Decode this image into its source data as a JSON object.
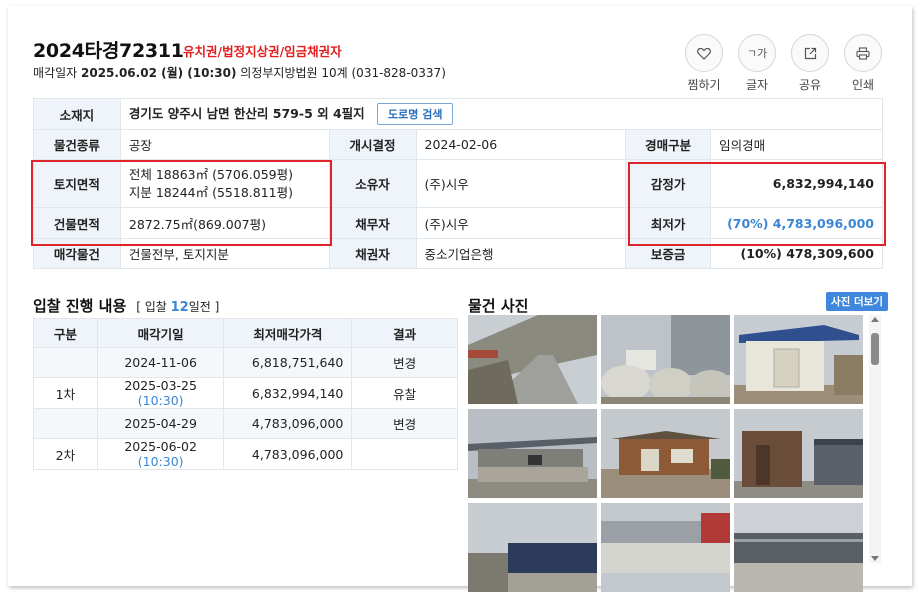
{
  "header": {
    "case_no": "2024타경72311",
    "tags": "유치권/법정지상권/임금채권자",
    "sale_date_label": "매각일자",
    "sale_date": "2025.06.02 (월) (10:30)",
    "court": "의정부지방법원 10계 (031-828-0337)"
  },
  "actions": [
    {
      "label": "찜하기",
      "icon": "heart-icon",
      "glyph": "♡"
    },
    {
      "label": "글자",
      "icon": "font-size-icon",
      "glyph": "ㄱ가"
    },
    {
      "label": "공유",
      "icon": "share-icon",
      "glyph": "⇱"
    },
    {
      "label": "인쇄",
      "icon": "print-icon",
      "glyph": "⎙"
    }
  ],
  "info": {
    "location_label": "소재지",
    "location": "경기도 양주시 남면 한산리 579-5 외 4필지",
    "road_button": "도로명 검색",
    "type_label": "물건종류",
    "type": "공장",
    "open_label": "개시결정",
    "open_date": "2024-02-06",
    "auction_label": "경매구분",
    "auction_type": "임의경매",
    "land_label": "토지면적",
    "land_total": "전체 18863㎡ (5706.059평)",
    "land_share": "지분 18244㎡ (5518.811평)",
    "owner_label": "소유자",
    "owner": "(주)시우",
    "appraisal_label": "감정가",
    "appraisal": "6,832,994,140",
    "bldg_label": "건물면적",
    "bldg_area": "2872.75㎡(869.007평)",
    "debtor_label": "채무자",
    "debtor": "(주)시우",
    "min_label": "최저가",
    "min_price": "(70%) 4,783,096,000",
    "item_label": "매각물건",
    "item": "건물전부, 토지지분",
    "creditor_label": "채권자",
    "creditor": "중소기업은행",
    "deposit_label": "보증금",
    "deposit": "(10%) 478,309,600"
  },
  "bidding": {
    "title": "입찰 진행 내용",
    "note_prefix": "[ 입찰",
    "note_days": "12",
    "note_suffix": "일전 ]",
    "columns": [
      "구분",
      "매각기일",
      "최저매각가격",
      "결과"
    ],
    "rows": [
      {
        "round": "",
        "date": "2024-11-06",
        "time": "",
        "price": "6,818,751,640",
        "result": "변경"
      },
      {
        "round": "1차",
        "date": "2025-03-25",
        "time": "(10:30)",
        "price": "6,832,994,140",
        "result": "유찰"
      },
      {
        "round": "",
        "date": "2025-04-29",
        "time": "",
        "price": "4,783,096,000",
        "result": "변경"
      },
      {
        "round": "2차",
        "date": "2025-06-02",
        "time": "(10:30)",
        "price": "4,783,096,000",
        "result": ""
      }
    ]
  },
  "photos": {
    "title": "물건 사진",
    "more_button": "사진 더보기"
  },
  "colors": {
    "accent": "#3a86d4",
    "tag_red": "#e02020",
    "header_bg": "#eef4f9",
    "highlight_box": "#e0242b"
  }
}
